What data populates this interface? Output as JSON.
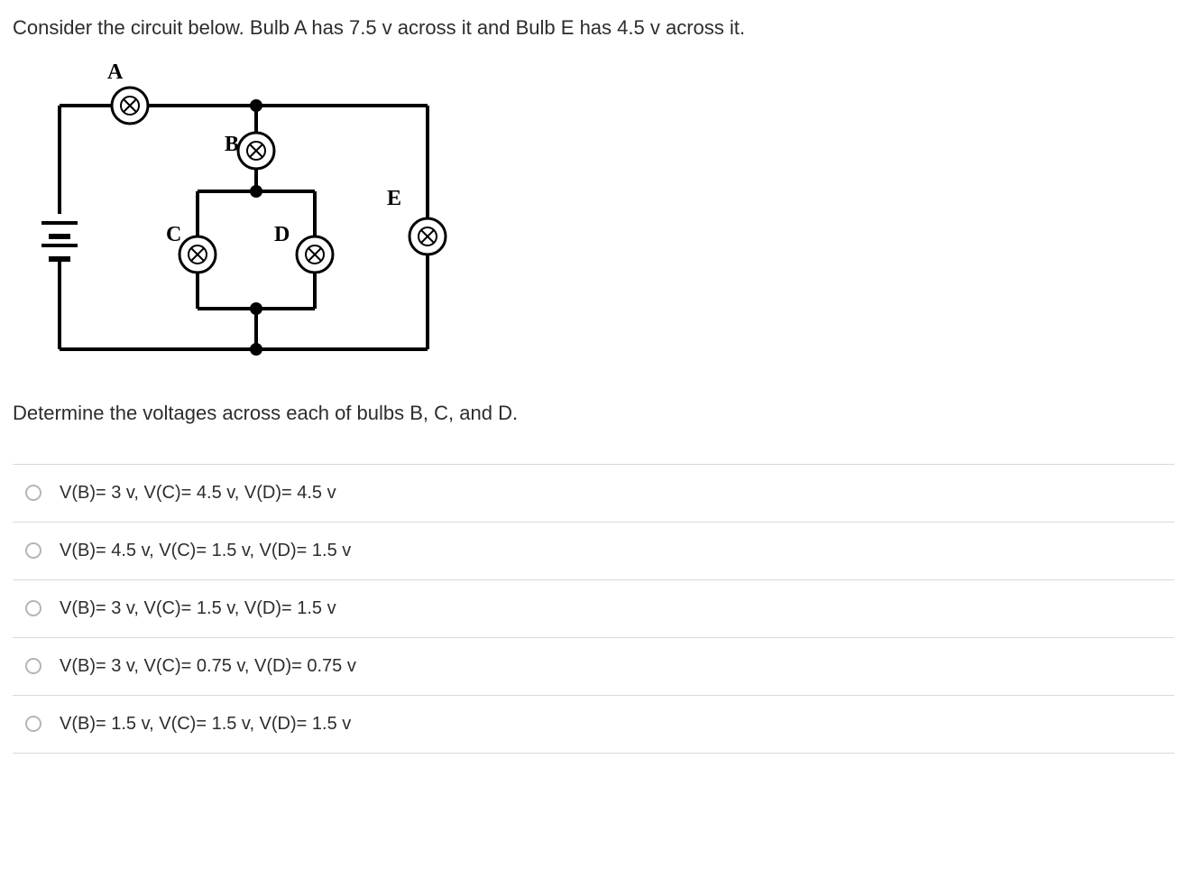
{
  "question": "Consider the circuit below. Bulb A has 7.5 v across it and Bulb E has 4.5 v across it.",
  "prompt": "Determine the voltages across each of bulbs B, C, and D.",
  "diagram": {
    "labels": {
      "A": "A",
      "B": "B",
      "C": "C",
      "D": "D",
      "E": "E"
    }
  },
  "options": [
    "V(B)= 3 v, V(C)= 4.5 v, V(D)= 4.5 v",
    "V(B)= 4.5 v, V(C)= 1.5 v, V(D)= 1.5 v",
    "V(B)= 3 v, V(C)= 1.5 v, V(D)= 1.5 v",
    "V(B)= 3 v, V(C)= 0.75 v, V(D)= 0.75 v",
    "V(B)= 1.5 v, V(C)= 1.5 v, V(D)= 1.5 v"
  ]
}
